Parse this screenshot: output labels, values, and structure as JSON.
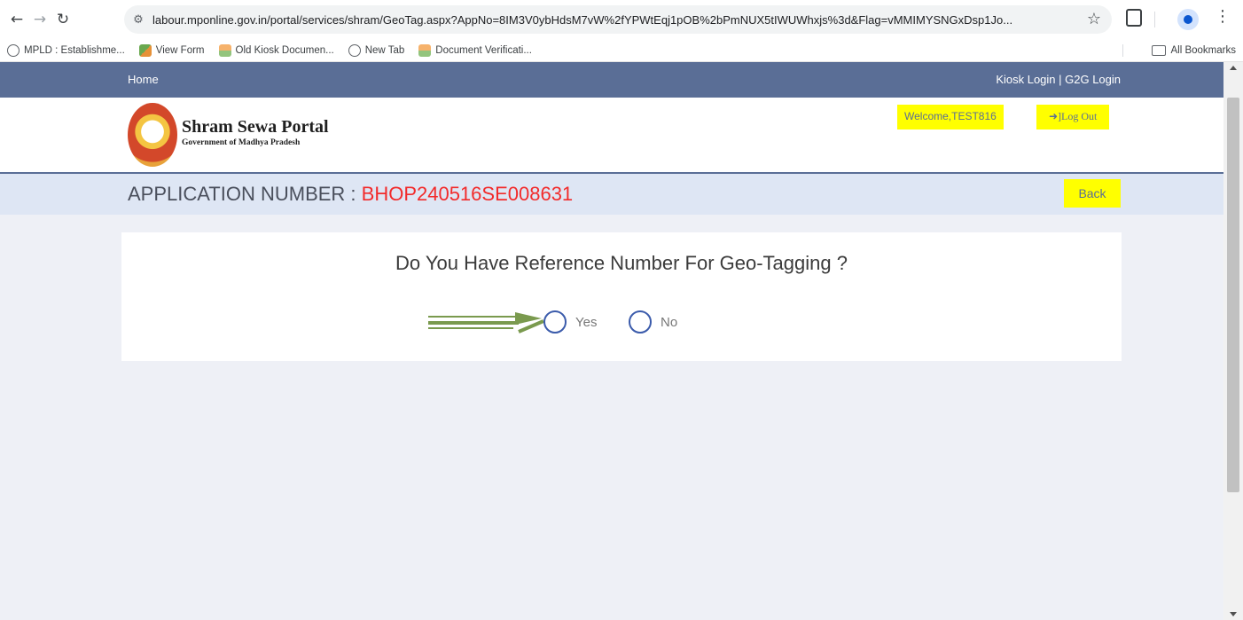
{
  "browser": {
    "url": "labour.mponline.gov.in/portal/services/shram/GeoTag.aspx?AppNo=8IM3V0ybHdsM7vW%2fYPWtEqj1pOB%2bPmNUX5tIWUWhxjs%3d&Flag=vMMIMYSNGxDsp1Jo...",
    "bookmarks": [
      {
        "label": "MPLD : Establishme...",
        "icon": "globe-icon"
      },
      {
        "label": "View Form",
        "icon": "form-icon"
      },
      {
        "label": "Old Kiosk Documen...",
        "icon": "document-icon"
      },
      {
        "label": "New Tab",
        "icon": "globe-icon"
      },
      {
        "label": "Document Verificati...",
        "icon": "document-icon"
      }
    ],
    "all_bookmarks": "All Bookmarks"
  },
  "nav": {
    "home": "Home",
    "logins": "Kiosk Login | G2G Login"
  },
  "header": {
    "title": "Shram Sewa Portal",
    "subtitle": "Government of Madhya Pradesh",
    "welcome": "Welcome,TEST816",
    "logout": "➜]Log Out"
  },
  "application": {
    "label": "APPLICATION NUMBER : ",
    "number": "BHOP240516SE008631",
    "back": "Back"
  },
  "question": {
    "text": "Do You Have Reference Number For Geo-Tagging ?",
    "options": [
      "Yes",
      "No"
    ],
    "selected": null
  },
  "colors": {
    "nav_bg": "#5a6e96",
    "highlight": "#ffff00",
    "app_number": "#f22b2b",
    "annotation_arrow": "#7a9a4e"
  }
}
